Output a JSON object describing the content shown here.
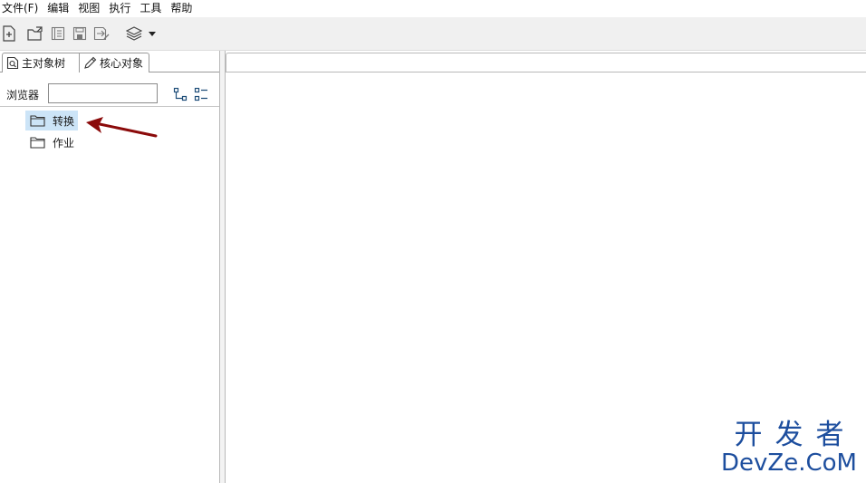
{
  "menubar": {
    "items": [
      {
        "label": "文件(F)"
      },
      {
        "label": "编辑"
      },
      {
        "label": "视图"
      },
      {
        "label": "执行"
      },
      {
        "label": "工具"
      },
      {
        "label": "帮助"
      }
    ]
  },
  "toolbar": {
    "icons": [
      "new-file-icon",
      "open-folder-icon",
      "explore-repository-icon",
      "save-icon",
      "save-as-icon",
      "layers-icon",
      "dropdown-arrow-icon"
    ]
  },
  "left_panel": {
    "tabs": [
      {
        "label": "主对象树",
        "icon": "search-page-icon",
        "active": true
      },
      {
        "label": "核心对象",
        "icon": "pencil-icon",
        "active": false
      }
    ],
    "browser": {
      "label": "浏览器",
      "value": ""
    },
    "tree": [
      {
        "label": "转换",
        "icon": "folder-icon",
        "selected": true
      },
      {
        "label": "作业",
        "icon": "folder-icon",
        "selected": false
      }
    ]
  },
  "annotation": {
    "color": "#8b0a0a"
  },
  "watermark": {
    "cn": "开发者",
    "en": "DevZe.CoM",
    "color": "#1d4e9e"
  },
  "colors": {
    "selection": "#cce4f7",
    "toolbar_bg": "#f0f0f0"
  }
}
